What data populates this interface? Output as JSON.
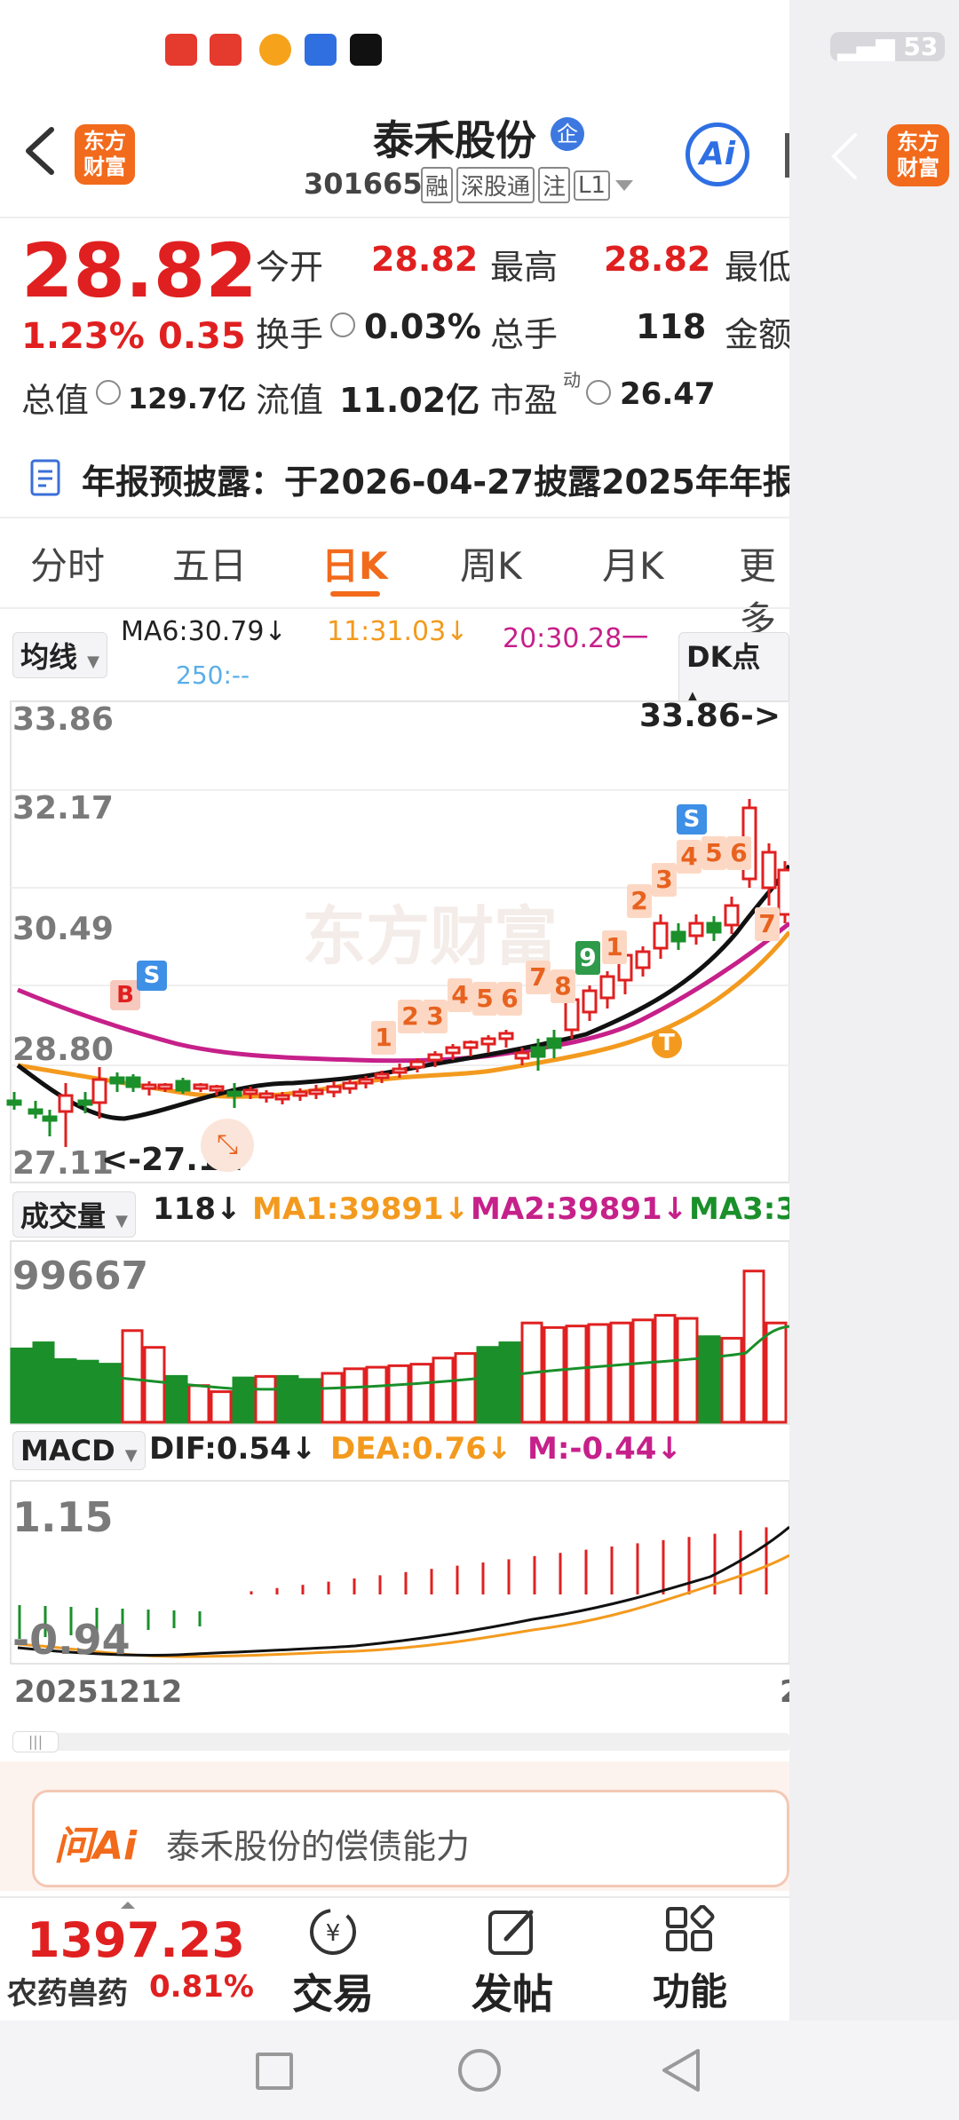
{
  "status_bar": {
    "signal_text": "53"
  },
  "header": {
    "stock_name": "泰禾股份",
    "badge": "企",
    "code": "301665",
    "tags": [
      "融",
      "深股通",
      "注",
      "L1"
    ],
    "logo_line1": "东方",
    "logo_line2": "财富",
    "ai_label": "Ai"
  },
  "quote": {
    "price": "28.82",
    "change_pct": "1.23%",
    "change_abs": "0.35",
    "total_value_label": "总值",
    "total_value": "129.7亿",
    "open_label": "今开",
    "open": "28.82",
    "high_label": "最高",
    "high": "28.82",
    "low_label": "最低",
    "turnover_label": "换手",
    "turnover": "0.03%",
    "volume_label": "总手",
    "volume": "118",
    "amount_label": "金额",
    "float_label": "流值",
    "float_value": "11.02亿",
    "pe_label": "市盈",
    "pe_sup": "动",
    "pe_value": "26.47"
  },
  "notice": {
    "text": "年报预披露：于2026-04-27披露2025年年报"
  },
  "tabs": {
    "items": [
      "分时",
      "五日",
      "日K",
      "周K",
      "月K",
      "更多"
    ],
    "active": "日K"
  },
  "kline": {
    "ma_selector": "均线",
    "ma6": "MA6:30.79↓",
    "ma11": "11:31.03↓",
    "ma20": "20:30.28一",
    "ma250": "250:--",
    "dk_label": "DK点",
    "watermark": "东方财富",
    "y_labels": [
      "33.86",
      "32.17",
      "30.49",
      "28.80",
      "27.11"
    ],
    "max_label": "33.86->",
    "min_label": "<-27.11",
    "signal_b": "B",
    "signal_s": "S",
    "signal_t": "T",
    "count_seq1": [
      "1",
      "2",
      "3",
      "4",
      "5",
      "6",
      "7",
      "8"
    ],
    "count_seq2": [
      "9",
      "1",
      "2",
      "3",
      "4",
      "5",
      "6",
      "7"
    ]
  },
  "volume_panel": {
    "selector": "成交量",
    "value": "118↓",
    "ma1": "MA1:39891↓",
    "ma2": "MA2:39891↓",
    "ma3": "MA3:3",
    "max_label": "99667"
  },
  "macd_panel": {
    "selector": "MACD",
    "dif": "DIF:0.54↓",
    "dea": "DEA:0.76↓",
    "m": "M:-0.44↓",
    "top_label": "1.15",
    "bottom_label": "-0.94",
    "date_label": "20251212",
    "date_right": "2"
  },
  "ask_ai": {
    "logo": "问Ai",
    "placeholder": "泰禾股份的偿债能力"
  },
  "bottom_bar": {
    "index_value": "1397.23",
    "index_name": "农药兽药",
    "index_change": "0.81%",
    "trade_label": "交易",
    "post_label": "发帖",
    "function_label": "功能"
  },
  "overlay": {
    "logo_line1": "东方",
    "logo_line2": "财富"
  },
  "colors": {
    "up": "#e02020",
    "down": "#1a8f2a",
    "ma_black": "#111111",
    "ma_orange": "#f39a1e",
    "ma_magenta": "#c6208a",
    "brand": "#f26a1b"
  }
}
